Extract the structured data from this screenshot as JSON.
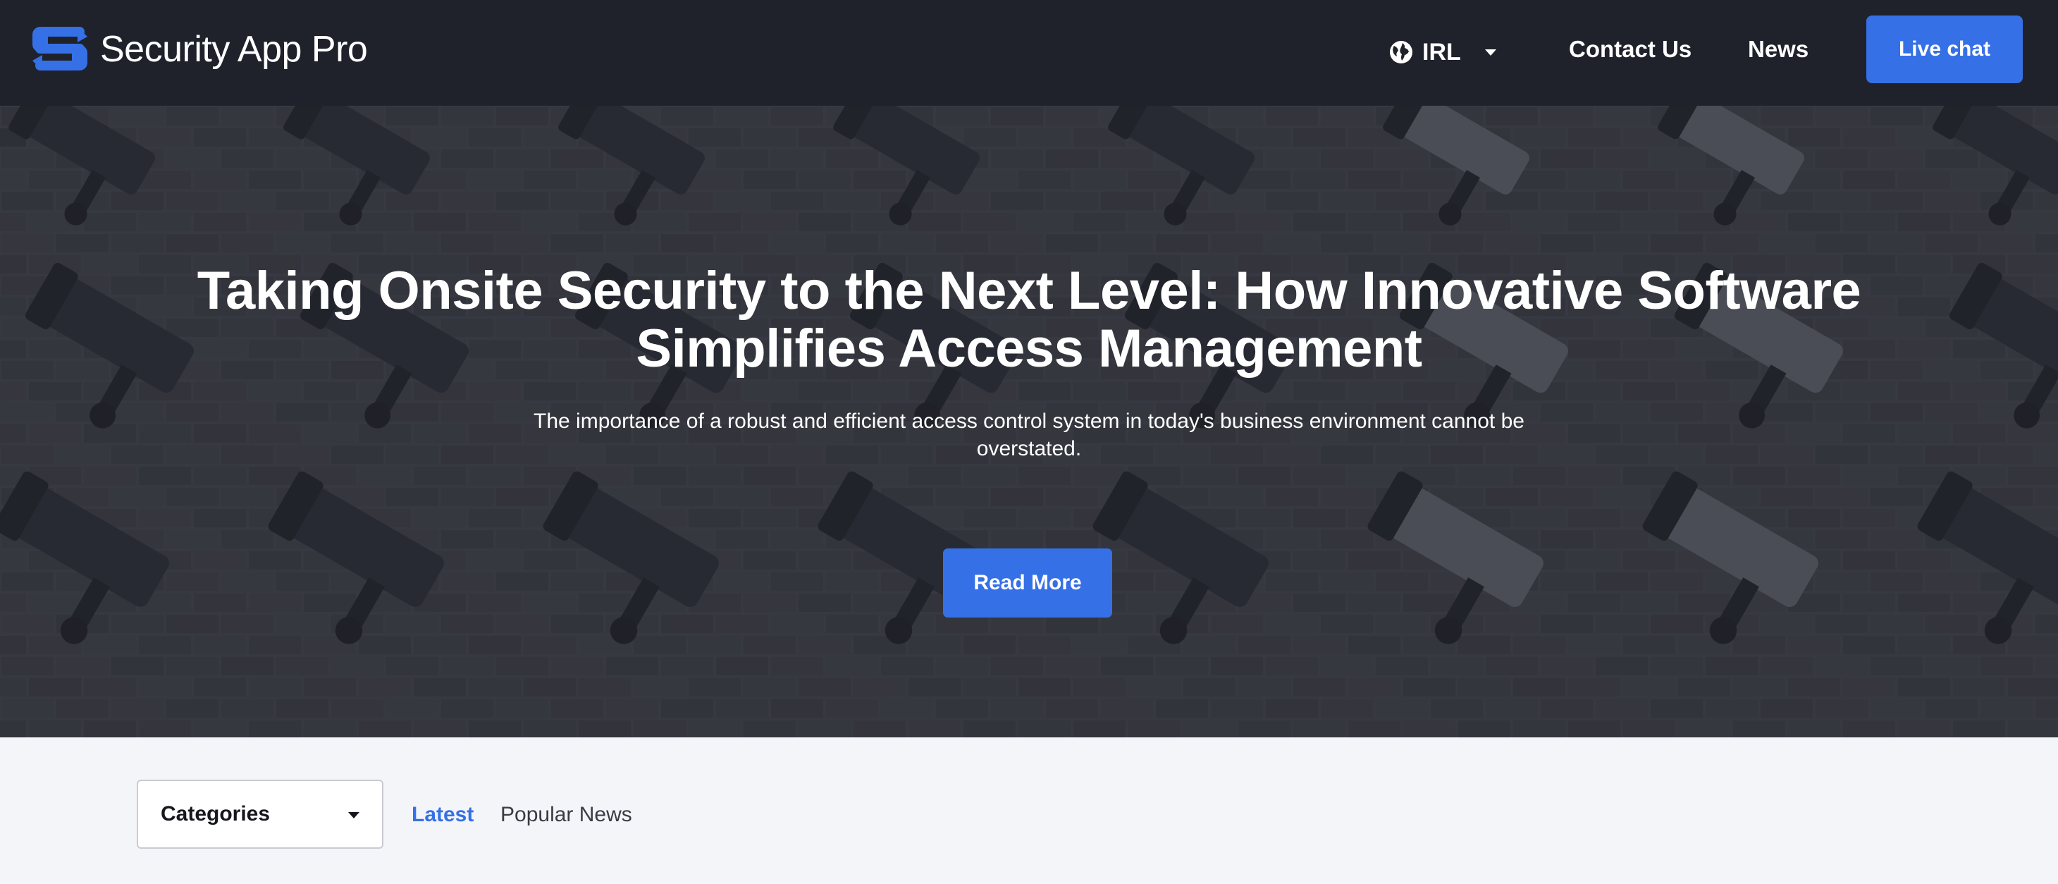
{
  "header": {
    "brand": "Security App Pro",
    "region": "IRL",
    "nav_links": [
      "Contact Us",
      "News"
    ],
    "cta": "Live chat"
  },
  "hero": {
    "title": "Taking Onsite Security to the Next Level: How Innovative Software Simplifies Access Management",
    "subtitle": "The importance of a robust and efficient access control system in today's business environment cannot be overstated.",
    "button": "Read More"
  },
  "filters": {
    "category_select": "Categories",
    "tabs": [
      "Latest",
      "Popular News"
    ],
    "active_tab": "Latest"
  },
  "colors": {
    "accent": "#3570e6",
    "nav_bg": "#1f222b",
    "page_bg": "#f4f5f9"
  },
  "icons": [
    "logo-icon",
    "globe-icon",
    "chevron-down-icon"
  ]
}
